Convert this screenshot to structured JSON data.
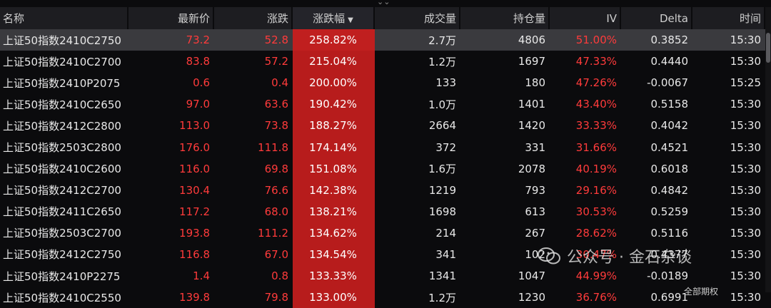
{
  "topbar": {
    "collapse_glyph": "⌄⌄"
  },
  "columns": [
    "名称",
    "最新价",
    "涨跌",
    "涨跌幅",
    "成交量",
    "持仓量",
    "IV",
    "Delta",
    "时间"
  ],
  "sort_indicator": "▼",
  "rows": [
    {
      "name": "上证50指数2410C2750",
      "price": "73.2",
      "change": "52.8",
      "pct": "258.82%",
      "volume": "2.7万",
      "oi": "4806",
      "iv": "51.00%",
      "delta": "0.3852",
      "time": "15:30"
    },
    {
      "name": "上证50指数2410C2700",
      "price": "83.8",
      "change": "57.2",
      "pct": "215.04%",
      "volume": "1.2万",
      "oi": "1697",
      "iv": "47.33%",
      "delta": "0.4440",
      "time": "15:30"
    },
    {
      "name": "上证50指数2410P2075",
      "price": "0.6",
      "change": "0.4",
      "pct": "200.00%",
      "volume": "133",
      "oi": "180",
      "iv": "47.26%",
      "delta": "-0.0067",
      "time": "15:25"
    },
    {
      "name": "上证50指数2410C2650",
      "price": "97.0",
      "change": "63.6",
      "pct": "190.42%",
      "volume": "1.0万",
      "oi": "1401",
      "iv": "43.40%",
      "delta": "0.5158",
      "time": "15:30"
    },
    {
      "name": "上证50指数2412C2800",
      "price": "113.0",
      "change": "73.8",
      "pct": "188.27%",
      "volume": "2664",
      "oi": "1420",
      "iv": "33.33%",
      "delta": "0.4042",
      "time": "15:30"
    },
    {
      "name": "上证50指数2503C2800",
      "price": "176.0",
      "change": "111.8",
      "pct": "174.14%",
      "volume": "372",
      "oi": "331",
      "iv": "31.66%",
      "delta": "0.4521",
      "time": "15:30"
    },
    {
      "name": "上证50指数2410C2600",
      "price": "116.0",
      "change": "69.8",
      "pct": "151.08%",
      "volume": "1.6万",
      "oi": "2078",
      "iv": "40.19%",
      "delta": "0.6018",
      "time": "15:30"
    },
    {
      "name": "上证50指数2412C2700",
      "price": "130.4",
      "change": "76.6",
      "pct": "142.38%",
      "volume": "1219",
      "oi": "793",
      "iv": "29.16%",
      "delta": "0.4842",
      "time": "15:30"
    },
    {
      "name": "上证50指数2411C2650",
      "price": "117.2",
      "change": "68.0",
      "pct": "138.21%",
      "volume": "1698",
      "oi": "613",
      "iv": "30.53%",
      "delta": "0.5259",
      "time": "15:30"
    },
    {
      "name": "上证50指数2503C2700",
      "price": "193.8",
      "change": "111.2",
      "pct": "134.62%",
      "volume": "214",
      "oi": "267",
      "iv": "28.62%",
      "delta": "0.5116",
      "time": "15:30"
    },
    {
      "name": "上证50指数2412C2750",
      "price": "116.8",
      "change": "67.0",
      "pct": "134.54%",
      "volume": "341",
      "oi": "102",
      "iv": "30.47%",
      "delta": "0.4377",
      "time": "15:30"
    },
    {
      "name": "上证50指数2410P2275",
      "price": "1.4",
      "change": "0.8",
      "pct": "133.33%",
      "volume": "1341",
      "oi": "1047",
      "iv": "44.99%",
      "delta": "-0.0189",
      "time": "15:30"
    },
    {
      "name": "上证50指数2410C2550",
      "price": "139.8",
      "change": "79.8",
      "pct": "133.00%",
      "volume": "1.2万",
      "oi": "1230",
      "iv": "36.76%",
      "delta": "0.6991",
      "time": "15:30"
    }
  ],
  "watermark": {
    "text": "公众号 · 金石杂谈"
  },
  "bottom_clip_text": "全部期权",
  "colors": {
    "up": "#ff3b3b",
    "pct_bg": "#b71c1c",
    "header_bg": "#1d1d21",
    "selected_bg": "#3a3a3e"
  }
}
